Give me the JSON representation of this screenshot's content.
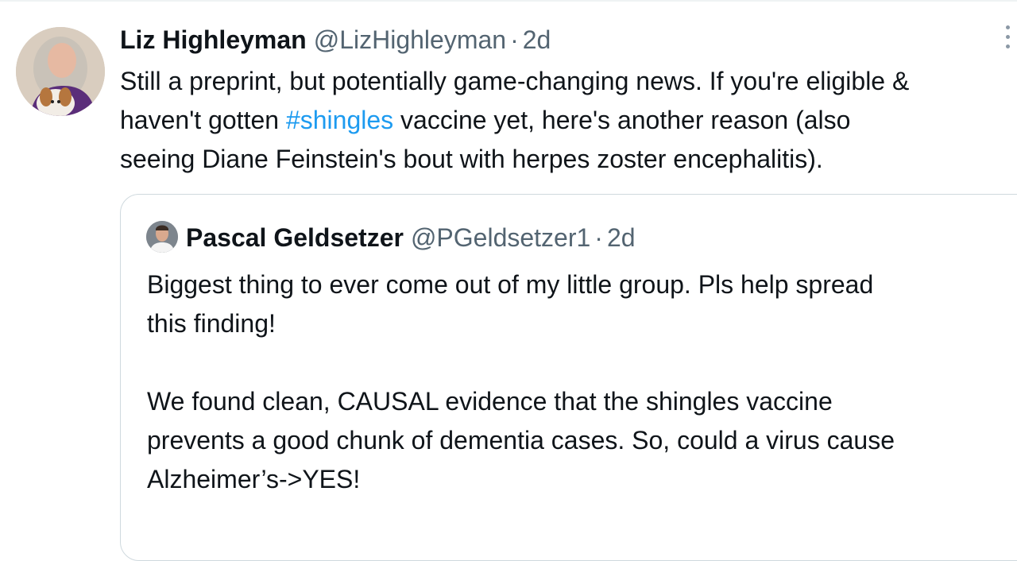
{
  "main_tweet": {
    "author_name": "Liz Highleyman",
    "handle": "@LizHighleyman",
    "separator": "·",
    "time": "2d",
    "body_lines": [
      {
        "before": "Still a preprint, but potentially game-changing news. If you're eligible &",
        "hashtag": "",
        "after": ""
      },
      {
        "before": "haven't gotten ",
        "hashtag": "#shingles",
        "after": " vaccine yet, here's another reason (also"
      },
      {
        "before": "seeing Diane Feinstein's bout with herpes zoster encephalitis).",
        "hashtag": "",
        "after": ""
      }
    ]
  },
  "quoted_tweet": {
    "author_name": "Pascal Geldsetzer",
    "handle": "@PGeldsetzer1",
    "separator": "·",
    "time": "2d",
    "paragraph1": [
      "Biggest thing to ever come out of my little group. Pls help spread",
      "this finding!"
    ],
    "paragraph2": [
      "We found clean, CAUSAL evidence that the shingles vaccine",
      "prevents a good chunk of dementia cases. So, could a virus cause",
      "Alzheimer’s->YES!"
    ]
  },
  "icons": {
    "more": "more-options-icon"
  },
  "colors": {
    "text": "#0f1419",
    "secondary": "#536471",
    "link": "#1d9bf0",
    "border": "#cfd9de"
  }
}
